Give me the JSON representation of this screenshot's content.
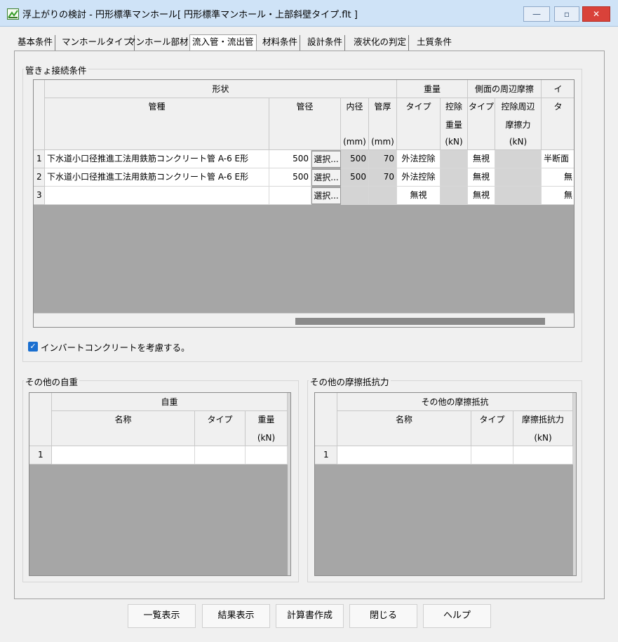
{
  "window": {
    "title": "浮上がりの検討 - 円形標準マンホール[ 円形標準マンホール・上部斜壁タイプ.flt ]",
    "min_label": "—",
    "max_label": "▫",
    "close_label": "✕"
  },
  "tabs": [
    "基本条件",
    "マンホールタイプ",
    "マンホール部材",
    "流入管・流出管",
    "材料条件",
    "設計条件",
    "液状化の判定",
    "土質条件"
  ],
  "active_tab": "流入管・流出管",
  "pipe_group": {
    "label": "管きょ接続条件",
    "headers": {
      "shape": "形状",
      "weight": "重量",
      "side_friction": "側面の周辺摩擦",
      "invert_partial": "イ",
      "pipe_type": "管種",
      "pipe_dia": "管径",
      "inner_dia": "内径",
      "thickness": "管厚",
      "w_type": "タイプ",
      "w_deduct_1": "控除",
      "w_deduct_2": "重量",
      "f_type": "タイプ",
      "f_deduct_1": "控除周辺",
      "f_deduct_2": "摩擦力",
      "invert_type": "タ",
      "mm1": "(mm)",
      "mm2": "(mm)",
      "kn1": "(kN)",
      "kn2": "(kN)"
    },
    "rows": [
      {
        "num": "1",
        "pipe_type": "下水道小口径推進工法用鉄筋コンクリート管 A-6 E形",
        "dia": "500",
        "select": "選択...",
        "inner": "500",
        "thick": "70",
        "w_type": "外法控除",
        "w_val": "",
        "f_type": "無視",
        "f_val": "",
        "invert": "半断面"
      },
      {
        "num": "2",
        "pipe_type": "下水道小口径推進工法用鉄筋コンクリート管 A-6 E形",
        "dia": "500",
        "select": "選択...",
        "inner": "500",
        "thick": "70",
        "w_type": "外法控除",
        "w_val": "",
        "f_type": "無視",
        "f_val": "",
        "invert": "無"
      },
      {
        "num": "3",
        "pipe_type": "",
        "dia": "",
        "select": "選択...",
        "inner": "",
        "thick": "",
        "w_type": "無視",
        "w_val": "",
        "f_type": "無視",
        "f_val": "",
        "invert": "無"
      }
    ]
  },
  "invert_checkbox": {
    "label": "インバートコンクリートを考慮する。",
    "checked": true
  },
  "self_weight_group": {
    "label": "その他の自重",
    "header_top": "自重",
    "col_name": "名称",
    "col_type": "タイプ",
    "col_weight": "重量",
    "col_unit": "(kN)",
    "rows": [
      {
        "num": "1",
        "name": "",
        "type": "",
        "weight": ""
      }
    ]
  },
  "friction_group": {
    "label": "その他の摩擦抵抗力",
    "header_top": "その他の摩擦抵抗",
    "col_name": "名称",
    "col_type": "タイプ",
    "col_force": "摩擦抵抗力",
    "col_unit": "(kN)",
    "rows": [
      {
        "num": "1",
        "name": "",
        "type": "",
        "force": ""
      }
    ]
  },
  "buttons": {
    "list": "一覧表示",
    "result": "結果表示",
    "report": "計算書作成",
    "close": "閉じる",
    "help": "ヘルプ"
  },
  "colors": {
    "checkbox": "#1a6fd0",
    "close_button": "#d9423a",
    "grid_background": "#a6a6a6"
  }
}
